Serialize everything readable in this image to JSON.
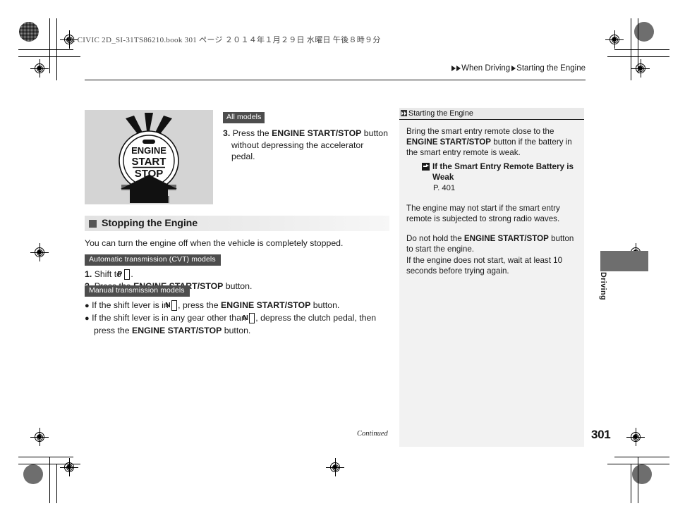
{
  "meta": {
    "file_stamp": "14 CIVIC 2D_SI-31TS86210.book   301 ページ   ２０１４年１月２９日   水曜日   午後８時９分",
    "page_number": "301",
    "continued_label": "Continued",
    "thumb_tab_label": "Driving"
  },
  "breadcrumb": {
    "level1": "When Driving",
    "level2": "Starting the Engine"
  },
  "figure": {
    "button_line1": "ENGINE",
    "button_line2": "START",
    "button_line3": "STOP",
    "alt_name": "engine-start-stop-button-illustration"
  },
  "step3": {
    "badge": "All models",
    "number": "3.",
    "text_before": "Press the ",
    "bold": "ENGINE START/STOP",
    "text_after": " button without depressing the accelerator pedal."
  },
  "section": {
    "heading": "Stopping the Engine",
    "lead": "You can turn the engine off when the vehicle is completely stopped."
  },
  "automatic": {
    "badge": "Automatic transmission (CVT) models",
    "items": [
      {
        "num": "1.",
        "pre": "Shift to ",
        "gear": "P",
        "post": "."
      },
      {
        "num": "2.",
        "pre": "Press the ",
        "bold": "ENGINE START/STOP",
        "post": " button."
      }
    ]
  },
  "manual": {
    "badge": "Manual transmission models",
    "items": [
      {
        "pre": "If the shift lever is in ",
        "gear": "N",
        "mid": ", press the ",
        "bold": "ENGINE START/STOP",
        "post": " button."
      },
      {
        "pre": "If the shift lever is in any gear other than ",
        "gear": "N",
        "mid": ", depress the clutch pedal, then press the ",
        "bold": "ENGINE START/STOP",
        "post": " button."
      }
    ]
  },
  "sidebar": {
    "title": "Starting the Engine",
    "para1_a": "Bring the smart entry remote close to the ",
    "para1_bold": "ENGINE START/STOP",
    "para1_b": " button if the battery in the smart entry remote is weak.",
    "reference_title": "If the Smart Entry Remote Battery is Weak",
    "reference_page": "P. 401",
    "para2": "The engine may not start if the smart entry remote is subjected to strong radio waves.",
    "para3_a": "Do not hold the ",
    "para3_bold": "ENGINE START/STOP",
    "para3_b": " button to start the engine.",
    "para4": "If the engine does not start, wait at least 10 seconds before trying again."
  },
  "colors": {
    "figure_bg": "#d4d4d4",
    "badge_bg": "#4d4d4d",
    "sidebar_bg": "#f2f2f2",
    "sidebar_head_bg": "#e9e9e9",
    "thumb_tab": "#6e6e6e"
  }
}
